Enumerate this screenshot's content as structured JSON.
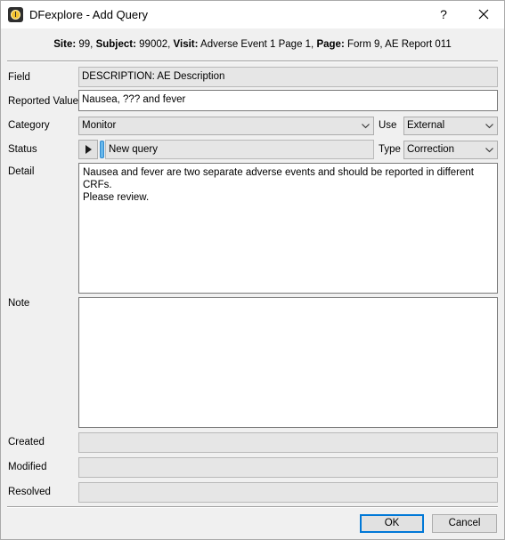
{
  "window": {
    "title": "DFexplore - Add Query",
    "help_label": "?",
    "icons": {
      "app": "dfexplore-clock-icon",
      "close": "close-icon"
    }
  },
  "context": {
    "site_label": "Site:",
    "site_value": "99,",
    "subject_label": "Subject:",
    "subject_value": "99002,",
    "visit_label": "Visit:",
    "visit_value": "Adverse Event 1 Page 1,",
    "page_label": "Page:",
    "page_value": "Form 9, AE Report 011"
  },
  "form": {
    "field_label": "Field",
    "field_value": "DESCRIPTION: AE Description",
    "reported_value_label": "Reported Value",
    "reported_value": "Nausea, ??? and fever",
    "category_label": "Category",
    "category_value": "Monitor",
    "use_label": "Use",
    "use_value": "External",
    "status_label": "Status",
    "status_value": "New query",
    "type_label": "Type",
    "type_value": "Correction",
    "detail_label": "Detail",
    "detail_text": "Nausea and fever are two separate adverse events and should be reported in different CRFs.\nPlease review.",
    "note_label": "Note",
    "note_text": "",
    "created_label": "Created",
    "created_value": "",
    "modified_label": "Modified",
    "modified_value": "",
    "resolved_label": "Resolved",
    "resolved_value": ""
  },
  "buttons": {
    "ok": "OK",
    "cancel": "Cancel"
  },
  "colors": {
    "status_indicator": "#67b7ea",
    "default_button_border": "#0078d7"
  }
}
